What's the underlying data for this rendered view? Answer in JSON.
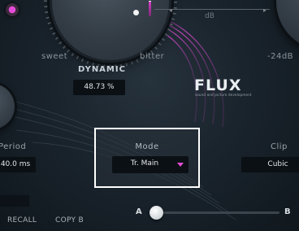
{
  "top": {
    "db_label": "dB",
    "sweet_label": "sweet",
    "bitter_label": "bitter",
    "right_knob_min_label": "-24dB"
  },
  "dynamic": {
    "title": "DYNAMIC",
    "value": "48.73 %"
  },
  "logo": {
    "name": "FLUX",
    "tagline": "sound and picture development"
  },
  "period": {
    "label": "Period",
    "value": "40.0 ms"
  },
  "mode": {
    "label": "Mode",
    "selected": "Tr. Main"
  },
  "clip": {
    "label": "Clip",
    "value": "Cubic"
  },
  "bottom": {
    "recall_label": "RECALL",
    "copy_b_label": "COPY B",
    "a_label": "A",
    "b_label": "B",
    "ab_morph": 0.0
  },
  "colors": {
    "accent": "#e64bd7",
    "background": "#1a242d",
    "selection_frame": "#ffffff"
  }
}
